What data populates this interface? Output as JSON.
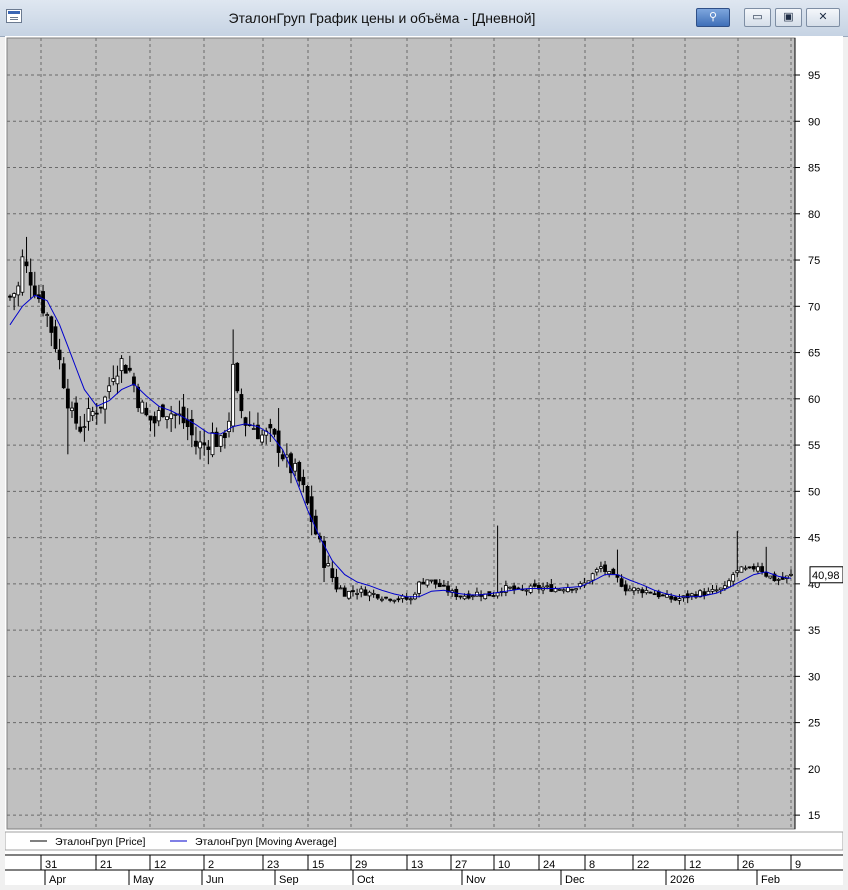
{
  "window": {
    "title": "ЭталонГруп График цены и объёма - [Дневной]",
    "controls": {
      "pin": "⚲",
      "minimize": "▭",
      "maximize": "▣",
      "close": "✕"
    }
  },
  "colors": {
    "plot_bg": "#c0c0c0",
    "grid": "#6a6a6a",
    "price": "#000000",
    "ma": "#0000cc"
  },
  "chart_data": {
    "type": "candlestick",
    "y_ticks": [
      95,
      90,
      85,
      80,
      75,
      70,
      65,
      60,
      55,
      50,
      45,
      40,
      35,
      30,
      25,
      20,
      15
    ],
    "ylim": [
      13.5,
      99
    ],
    "y_side": "right",
    "last_value_label": "40,98",
    "last_value": 40.98,
    "x_day_labels": [
      "31",
      "21",
      "12",
      "2",
      "23",
      "15",
      "29",
      "13",
      "27",
      "10",
      "24",
      "8",
      "22",
      "12",
      "26",
      "9"
    ],
    "x_month_labels": [
      "Apr",
      "May",
      "Jun",
      "Sep",
      "Oct",
      "Nov",
      "Dec",
      "2026",
      "Feb"
    ],
    "legend": [
      {
        "name": "ЭталонГруп [Price]",
        "color": "#000000"
      },
      {
        "name": "ЭталонГруп [Moving Average]",
        "color": "#0000cc"
      }
    ],
    "grid": true,
    "price_anchors": [
      [
        0,
        71
      ],
      [
        2,
        72
      ],
      [
        3,
        75
      ],
      [
        5,
        73
      ],
      [
        7,
        71
      ],
      [
        9,
        69
      ],
      [
        11,
        66
      ],
      [
        13,
        62
      ],
      [
        15,
        58
      ],
      [
        17,
        57
      ],
      [
        19,
        58
      ],
      [
        21,
        59
      ],
      [
        23,
        60
      ],
      [
        25,
        63
      ],
      [
        27,
        64
      ],
      [
        29,
        63
      ],
      [
        31,
        60
      ],
      [
        33,
        58
      ],
      [
        35,
        57.5
      ],
      [
        37,
        59
      ],
      [
        39,
        58.5
      ],
      [
        41,
        58
      ],
      [
        43,
        57
      ],
      [
        45,
        55
      ],
      [
        47,
        55
      ],
      [
        49,
        56
      ],
      [
        51,
        55
      ],
      [
        53,
        58
      ],
      [
        54,
        63
      ],
      [
        55,
        60
      ],
      [
        57,
        57.5
      ],
      [
        59,
        57
      ],
      [
        61,
        56
      ],
      [
        63,
        56
      ],
      [
        65,
        55
      ],
      [
        67,
        53
      ],
      [
        69,
        52
      ],
      [
        71,
        50
      ],
      [
        73,
        47
      ],
      [
        75,
        44
      ],
      [
        77,
        41.5
      ],
      [
        79,
        40
      ],
      [
        81,
        39
      ],
      [
        83,
        39.2
      ],
      [
        85,
        39.2
      ],
      [
        87,
        39
      ],
      [
        89,
        38.8
      ],
      [
        91,
        38.5
      ],
      [
        93,
        38.5
      ],
      [
        95,
        38.4
      ],
      [
        97,
        38.3
      ],
      [
        99,
        40
      ],
      [
        101,
        40.5
      ],
      [
        103,
        40
      ],
      [
        105,
        39.5
      ],
      [
        107,
        39
      ],
      [
        109,
        38.7
      ],
      [
        111,
        38.8
      ],
      [
        113,
        39
      ],
      [
        115,
        38.8
      ],
      [
        117,
        38.9
      ],
      [
        119,
        39.5
      ],
      [
        121,
        39.5
      ],
      [
        123,
        39.2
      ],
      [
        125,
        39.4
      ],
      [
        127,
        39.5
      ],
      [
        129,
        39.6
      ],
      [
        131,
        39.5
      ],
      [
        133,
        39.5
      ],
      [
        135,
        39.7
      ],
      [
        137,
        39.6
      ],
      [
        139,
        40
      ],
      [
        141,
        41
      ],
      [
        143,
        41.8
      ],
      [
        145,
        41
      ],
      [
        147,
        40.5
      ],
      [
        149,
        39.5
      ],
      [
        151,
        39.4
      ],
      [
        153,
        39.3
      ],
      [
        155,
        39.2
      ],
      [
        157,
        38.8
      ],
      [
        159,
        38.5
      ],
      [
        161,
        38.3
      ],
      [
        163,
        38.5
      ],
      [
        165,
        38.8
      ],
      [
        167,
        39
      ],
      [
        169,
        39
      ],
      [
        171,
        39.3
      ],
      [
        173,
        39.5
      ],
      [
        175,
        41
      ],
      [
        177,
        41.5
      ],
      [
        179,
        41.5
      ],
      [
        181,
        42
      ],
      [
        183,
        41
      ],
      [
        185,
        40.5
      ],
      [
        187,
        40.5
      ],
      [
        189,
        40.9
      ]
    ],
    "spikes": [
      {
        "bar": 4,
        "high": 77.5
      },
      {
        "bar": 14,
        "low": 54
      },
      {
        "bar": 54,
        "high": 67.5
      },
      {
        "bar": 65,
        "high": 59
      },
      {
        "bar": 118,
        "high": 46.3
      },
      {
        "bar": 176,
        "high": 45.7
      },
      {
        "bar": 147,
        "high": 43.7
      },
      {
        "bar": 183,
        "high": 44
      }
    ],
    "ma_anchors": [
      [
        0,
        68
      ],
      [
        3,
        70
      ],
      [
        6,
        71.2
      ],
      [
        9,
        70.6
      ],
      [
        12,
        68
      ],
      [
        15,
        64.5
      ],
      [
        18,
        61
      ],
      [
        21,
        59.2
      ],
      [
        24,
        59.8
      ],
      [
        27,
        61
      ],
      [
        30,
        61.6
      ],
      [
        33,
        60.3
      ],
      [
        36,
        59.2
      ],
      [
        39,
        58.7
      ],
      [
        42,
        58
      ],
      [
        45,
        57.2
      ],
      [
        48,
        56.3
      ],
      [
        51,
        56.2
      ],
      [
        54,
        57
      ],
      [
        57,
        57.3
      ],
      [
        60,
        57
      ],
      [
        63,
        56.2
      ],
      [
        66,
        54.5
      ],
      [
        69,
        51.5
      ],
      [
        72,
        48
      ],
      [
        75,
        45
      ],
      [
        78,
        42.5
      ],
      [
        81,
        41
      ],
      [
        84,
        40.2
      ],
      [
        87,
        39.8
      ],
      [
        90,
        39.3
      ],
      [
        93,
        38.9
      ],
      [
        96,
        38.6
      ],
      [
        99,
        38.6
      ],
      [
        102,
        39.2
      ],
      [
        105,
        39.3
      ],
      [
        108,
        39
      ],
      [
        111,
        38.8
      ],
      [
        114,
        38.8
      ],
      [
        117,
        39
      ],
      [
        120,
        39.2
      ],
      [
        123,
        39.4
      ],
      [
        126,
        39.5
      ],
      [
        129,
        39.5
      ],
      [
        132,
        39.5
      ],
      [
        135,
        39.6
      ],
      [
        138,
        39.7
      ],
      [
        141,
        40.3
      ],
      [
        144,
        41
      ],
      [
        147,
        41
      ],
      [
        150,
        40.4
      ],
      [
        153,
        39.9
      ],
      [
        156,
        39.3
      ],
      [
        159,
        38.9
      ],
      [
        162,
        38.6
      ],
      [
        165,
        38.6
      ],
      [
        168,
        38.7
      ],
      [
        171,
        39
      ],
      [
        174,
        39.6
      ],
      [
        177,
        40.3
      ],
      [
        180,
        41
      ],
      [
        183,
        41.3
      ],
      [
        186,
        40.8
      ],
      [
        189,
        40.6
      ]
    ]
  }
}
